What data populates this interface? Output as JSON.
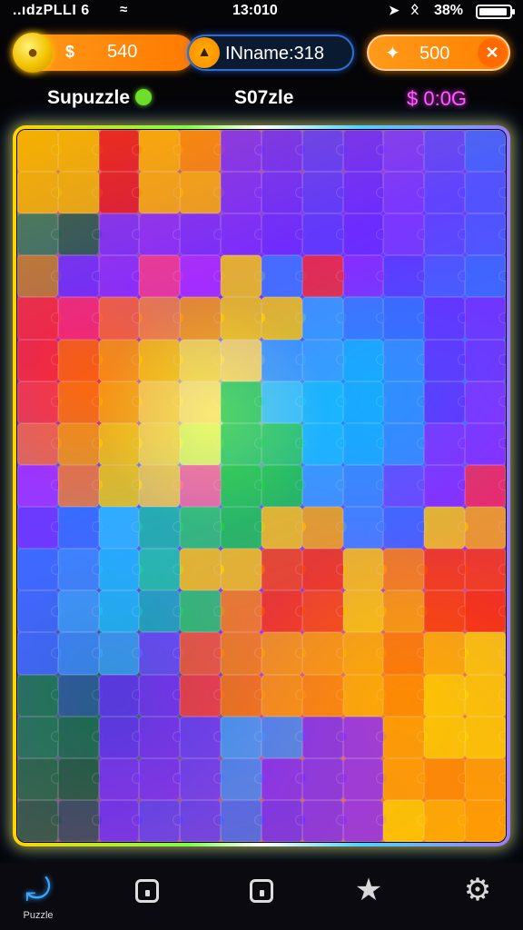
{
  "status_bar": {
    "carrier": "..ıdzPLLI 6",
    "time": "13:010",
    "battery_percent": "38%",
    "icons": [
      "wifi-icon",
      "location-arrow-icon",
      "bluetooth-icon",
      "battery-icon"
    ]
  },
  "hud": {
    "coins": {
      "symbol": "$",
      "amount": "540",
      "icon": "coin-mascot-icon"
    },
    "player": {
      "label": "INname:318",
      "icon": "player-avatar-icon"
    },
    "gems": {
      "amount": "500",
      "icon": "sparkle-icon",
      "button_icon": "close-x-icon"
    }
  },
  "labels": {
    "left": "Supuzzle",
    "middle": "S07zle",
    "right": "$ 0:0G"
  },
  "board": {
    "grid_columns": 12,
    "grid_rows": 17,
    "frame_colors": [
      "#ffd400",
      "#7cff4a",
      "#4fd2ff",
      "#9a7bff"
    ],
    "tiles": [
      "#f2b600",
      "#f2b600",
      "#e8131f",
      "#ffb000",
      "#ff8a00",
      "#7a2cff",
      "#6b2cff",
      "#5a3cff",
      "#6a2cff",
      "#7a3aff",
      "#5a4aff",
      "#3a6cff",
      "#f2b600",
      "#f2b600",
      "#e8131f",
      "#ffb000",
      "#ffb000",
      "#7a2cff",
      "#6b2cff",
      "#5a3cff",
      "#6a2cff",
      "#7a3aff",
      "#5a4aff",
      "#4a5cff",
      "#2a7a5a",
      "#1a5a4a",
      "#7a2cff",
      "#8a2cff",
      "#7a2cff",
      "#7a2cff",
      "#6b2cff",
      "#5a3cff",
      "#6a2cff",
      "#7a3aff",
      "#5a4aff",
      "#4a5cff",
      "#c08020",
      "#6b2cff",
      "#8a2cff",
      "#ff3a8a",
      "#b02cff",
      "#ffd000",
      "#3a7cff",
      "#ff2a2a",
      "#8a2cff",
      "#5a3cff",
      "#4a5cff",
      "#3a6cff",
      "#ff2a2a",
      "#ff2a6a",
      "#ff6a2a",
      "#ff8a2a",
      "#ffa000",
      "#ffd000",
      "#ffd000",
      "#3aa0ff",
      "#3a7cff",
      "#3a6cff",
      "#6a2cff",
      "#7a2cff",
      "#ff2a2a",
      "#ff6a00",
      "#ffa000",
      "#ffc800",
      "#ffe040",
      "#ffe060",
      "#3aa0ff",
      "#3aa6ff",
      "#1ab0ff",
      "#3a8cff",
      "#6a2cff",
      "#7a2cff",
      "#ff3a3a",
      "#ff7a00",
      "#ffb000",
      "#ffd840",
      "#ffe870",
      "#2ad060",
      "#3acaff",
      "#1ac0ff",
      "#1ab0ff",
      "#3a8cff",
      "#6a2cff",
      "#8a2cff",
      "#ff6a3a",
      "#ffa000",
      "#ffd000",
      "#ffe040",
      "#e8ff60",
      "#2ad060",
      "#2ad060",
      "#1ac0ff",
      "#1ab0ff",
      "#3a8cff",
      "#8a2cff",
      "#8a2cff",
      "#b02cff",
      "#ff7a2a",
      "#ffd000",
      "#ffd040",
      "#ff6a9a",
      "#1ad040",
      "#1ad040",
      "#3aa0ff",
      "#3a8cff",
      "#6a4aff",
      "#8a2cff",
      "#ff2a4a",
      "#7a2cff",
      "#3a6cff",
      "#2ac0ff",
      "#1ac0a0",
      "#2ad060",
      "#1ad040",
      "#ffd000",
      "#ffb000",
      "#3a8cff",
      "#3a6cff",
      "#ffd000",
      "#ffb000",
      "#3a6cff",
      "#3a8cff",
      "#1ac0ff",
      "#1ad0a0",
      "#ffd000",
      "#ffd000",
      "#ff4a00",
      "#ff3a00",
      "#ffd000",
      "#ff8a00",
      "#ff3a00",
      "#ff3a00",
      "#3a6cff",
      "#3aa0ff",
      "#1ac0ff",
      "#1ab0c0",
      "#2ad060",
      "#ff8a00",
      "#ff3a00",
      "#ff4a00",
      "#ffd000",
      "#ffa000",
      "#ff3a00",
      "#ff2a00",
      "#3a6cff",
      "#3a8cff",
      "#3aa0ff",
      "#6a4aff",
      "#ff5a2a",
      "#ff8a00",
      "#ffa000",
      "#ffa000",
      "#ffb000",
      "#ff7a00",
      "#ffb000",
      "#ffd000",
      "#1a7a4a",
      "#2a5a9a",
      "#6a2cff",
      "#7a2cff",
      "#ff3a3a",
      "#ff7a00",
      "#ff9a00",
      "#ff8a00",
      "#ffb000",
      "#ff8a00",
      "#ffd000",
      "#ffd000",
      "#1a7a4a",
      "#1a6a4a",
      "#6a2cff",
      "#7a2cff",
      "#6a3aff",
      "#3aa0ff",
      "#3a8cff",
      "#7a2cff",
      "#8a2cff",
      "#ffa000",
      "#ffd000",
      "#ffd000",
      "#1a6a3a",
      "#1a5a3a",
      "#7a2cff",
      "#7a2cff",
      "#6a3aff",
      "#3a8cff",
      "#7a2cff",
      "#7a2cff",
      "#8a2cff",
      "#ffa000",
      "#ff8a00",
      "#ffa000",
      "#1a5a3a",
      "#2a4a5a",
      "#6a2cff",
      "#5a3cff",
      "#5a3cff",
      "#3a6cff",
      "#6a2cff",
      "#7a2cff",
      "#8a2cff",
      "#ffd000",
      "#ffb000",
      "#ffa000"
    ]
  },
  "bottom_nav": [
    {
      "label": "Puzzle",
      "icon": "puzzle-piece-icon"
    },
    {
      "label": "",
      "icon": "home-outline-icon"
    },
    {
      "label": "",
      "icon": "home-outline-icon"
    },
    {
      "label": "",
      "icon": "star-badge-icon"
    },
    {
      "label": "",
      "icon": "gear-icon"
    }
  ]
}
